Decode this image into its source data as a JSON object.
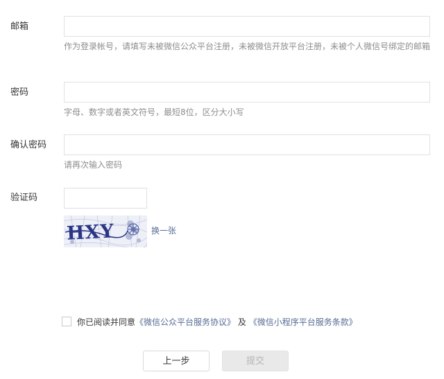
{
  "form": {
    "email": {
      "label": "邮箱",
      "value": "",
      "hint": "作为登录帐号，请填写未被微信公众平台注册，未被微信开放平台注册，未被个人微信号绑定的邮箱"
    },
    "password": {
      "label": "密码",
      "value": "",
      "hint": "字母、数字或者英文符号，最短8位，区分大小写"
    },
    "confirm_password": {
      "label": "确认密码",
      "value": "",
      "hint": "请再次输入密码"
    },
    "captcha": {
      "label": "验证码",
      "value": "",
      "image_text": "HXY",
      "refresh_label": "换一张"
    }
  },
  "agreement": {
    "prefix": "你已阅读并同意",
    "link1": "《微信公众平台服务协议》",
    "conjunction": "及",
    "link2": "《微信小程序平台服务条款》",
    "checked": false
  },
  "buttons": {
    "prev_label": "上一步",
    "submit_label": "提交"
  },
  "colors": {
    "link": "#576b95",
    "hint": "#8d8d8d",
    "border": "#e0e0e0",
    "disabled_bg": "#e9e9e9",
    "disabled_text": "#b5b5b5"
  }
}
